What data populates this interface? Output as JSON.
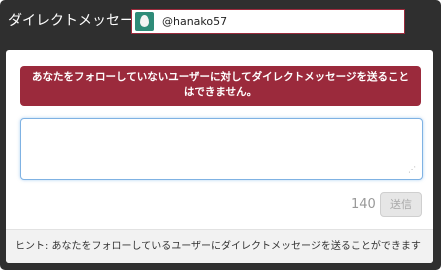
{
  "header": {
    "title": "ダイレクトメッセージ",
    "recipient": "@hanako57",
    "avatar_icon": "egg-avatar-icon",
    "avatar_color": "#2e8b78",
    "recipient_border_color": "#9b2a3c"
  },
  "error_banner": {
    "text": "あなたをフォローしていないユーザーに対してダイレクトメッセージを送ることはできません。",
    "color": "#9b2a3c"
  },
  "message": {
    "value": "",
    "placeholder": ""
  },
  "composer": {
    "char_count": "140",
    "send_label": "送信"
  },
  "hint": {
    "text": "ヒント: あなたをフォローしているユーザーにダイレクトメッセージを送ることができます"
  }
}
